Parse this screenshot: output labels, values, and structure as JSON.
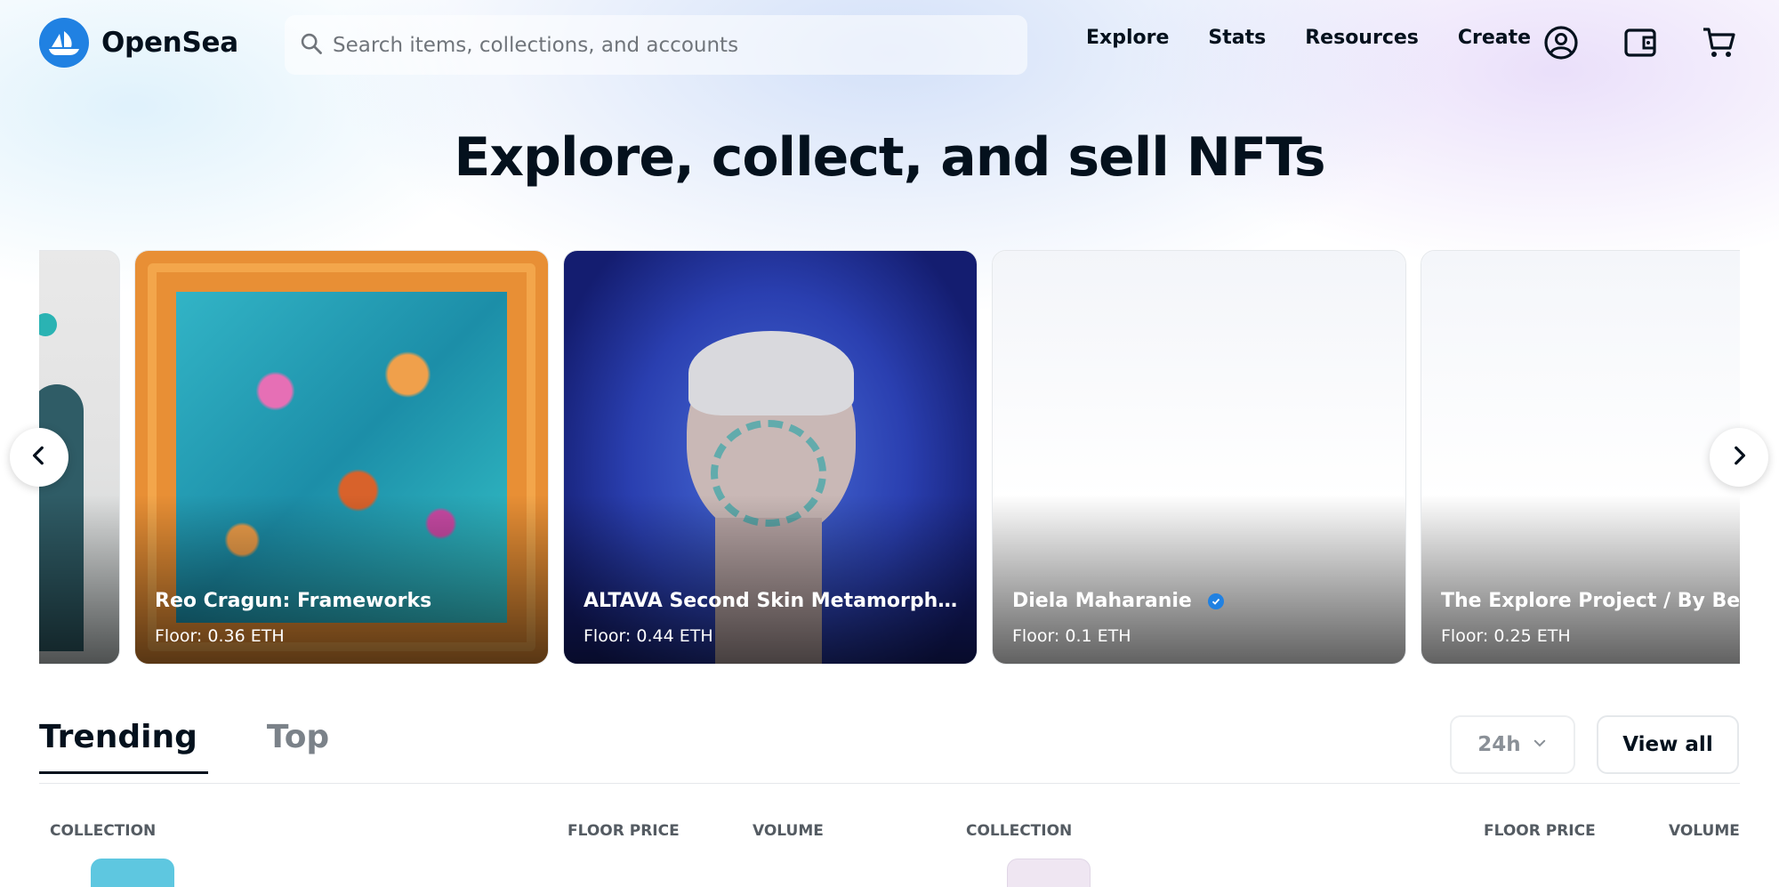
{
  "nav": {
    "logo_text": "OpenSea",
    "search_placeholder": "Search items, collections, and accounts",
    "links": [
      "Explore",
      "Stats",
      "Resources",
      "Create"
    ],
    "icons": [
      "account-icon",
      "wallet-icon",
      "cart-icon"
    ]
  },
  "hero": {
    "title": "Explore, collect, and sell NFTs"
  },
  "carousel": {
    "cards": [
      {
        "name": "",
        "floor": ""
      },
      {
        "name": "Reo Cragun: Frameworks",
        "floor": "Floor: 0.36 ETH"
      },
      {
        "name": "ALTAVA Second Skin Metamorphosis",
        "floor": "Floor: 0.44 ETH"
      },
      {
        "name": "Diela Maharanie",
        "floor": "Floor: 0.1 ETH",
        "verified": true
      },
      {
        "name": "The Explore Project / By Ben...",
        "floor": "Floor: 0.25 ETH"
      }
    ],
    "prev_icon": "chevron-left-icon",
    "next_icon": "chevron-right-icon"
  },
  "tabs": {
    "items": [
      "Trending",
      "Top"
    ],
    "active": "Trending"
  },
  "controls": {
    "period": "24h",
    "view_all": "View all"
  },
  "table": {
    "left_headers": [
      "COLLECTION",
      "FLOOR PRICE",
      "VOLUME"
    ],
    "right_headers": [
      "COLLECTION",
      "FLOOR PRICE",
      "VOLUME"
    ]
  },
  "colors": {
    "brand": "#2081e2",
    "text": "#04111d",
    "muted": "#7b8289"
  }
}
